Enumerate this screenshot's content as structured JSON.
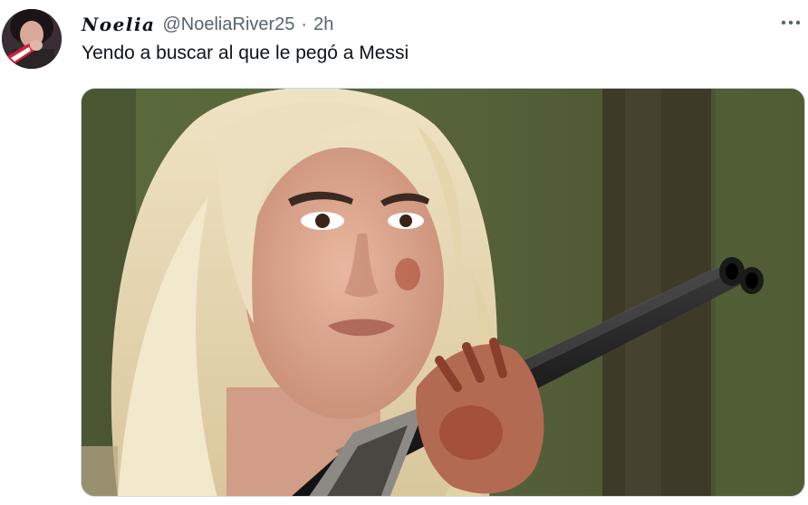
{
  "tweet": {
    "display_name": "Noelia",
    "handle": "@NoeliaRiver25",
    "separator": "·",
    "time": "2h",
    "text": "Yendo a buscar al que le pegó a Messi",
    "avatar_icon": "profile-photo",
    "more_icon": "more-horizontal-icon"
  },
  "colors": {
    "primary_text": "#0f1419",
    "secondary_text": "#536471",
    "media_border": "#cfd9de"
  }
}
